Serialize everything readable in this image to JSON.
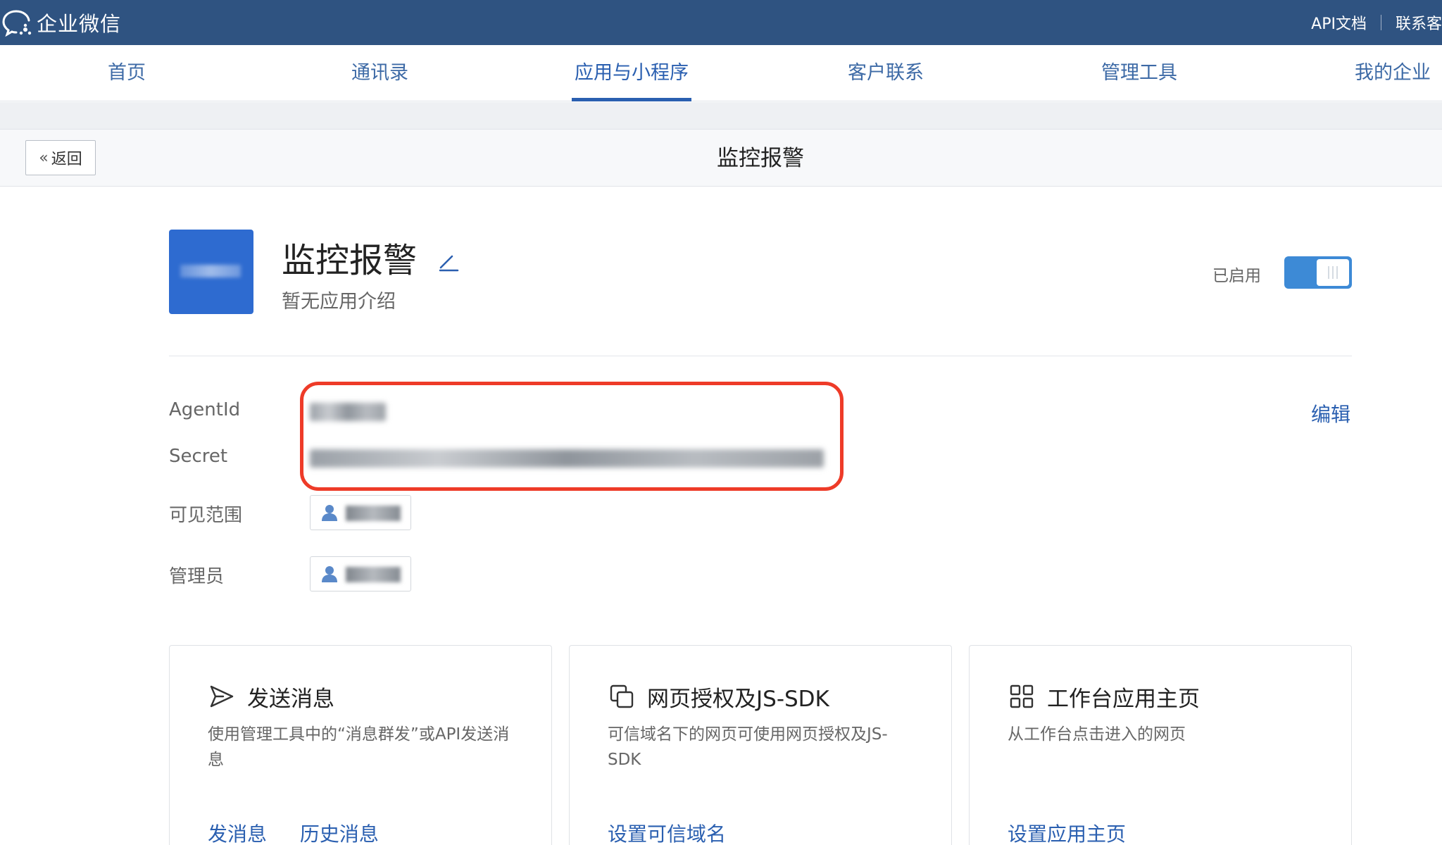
{
  "topbar": {
    "logo_text": "企业微信",
    "links": [
      "API文档",
      "联系客"
    ]
  },
  "nav": {
    "items": [
      "首页",
      "通讯录",
      "应用与小程序",
      "客户联系",
      "管理工具",
      "我的企业"
    ],
    "active": "应用与小程序"
  },
  "subheader": {
    "back_label": "返回",
    "title": "监控报警"
  },
  "app": {
    "name": "监控报警",
    "description": "暂无应用介绍",
    "status_label": "已启用",
    "enabled": true
  },
  "fields": {
    "agentid_label": "AgentId",
    "secret_label": "Secret",
    "visible_scope_label": "可见范围",
    "admin_label": "管理员",
    "edit_label": "编辑"
  },
  "cards": [
    {
      "icon": "send-icon",
      "title": "发送消息",
      "description": "使用管理工具中的“消息群发”或API发送消息",
      "links": [
        "发消息",
        "历史消息"
      ]
    },
    {
      "icon": "web-auth-icon",
      "title": "网页授权及JS-SDK",
      "description": "可信域名下的网页可使用网页授权及JS-SDK",
      "links": [
        "设置可信域名"
      ]
    },
    {
      "icon": "grid-icon",
      "title": "工作台应用主页",
      "description": "从工作台点击进入的网页",
      "links": [
        "设置应用主页"
      ]
    }
  ],
  "colors": {
    "topbar_bg": "#2f5381",
    "accent": "#2a5fb0",
    "highlight_border": "#ee3b28",
    "toggle_on": "#3d8ad6"
  }
}
